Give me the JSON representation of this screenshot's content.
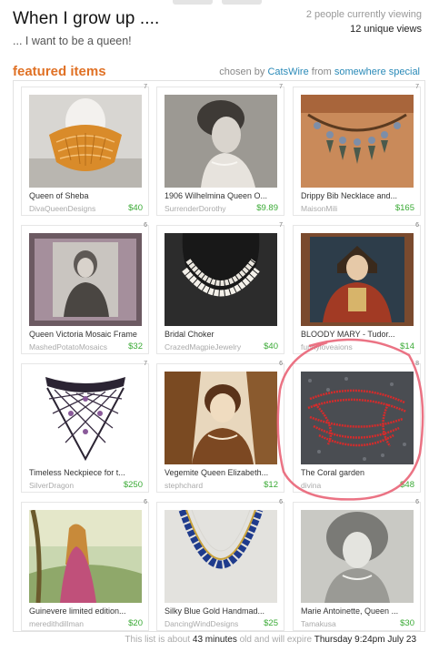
{
  "header": {
    "title": "When I grow up ....",
    "subtitle": "... I want to be a queen!",
    "viewing": "2 people currently viewing",
    "views": "12 unique views"
  },
  "featured": {
    "label": "featured items",
    "chosen_prefix": "chosen by",
    "curator": "CatsWire",
    "from_word": "from",
    "location": "somewhere special"
  },
  "items": [
    {
      "num": "7",
      "title": "Queen of Sheba",
      "seller": "DivaQueenDesigns",
      "price": "$40"
    },
    {
      "num": "7",
      "title": "1906  Wilhelmina Queen O...",
      "seller": "SurrenderDorothy",
      "price": "$9.89"
    },
    {
      "num": "7",
      "title": "Drippy Bib Necklace and...",
      "seller": "MaisonMili",
      "price": "$165"
    },
    {
      "num": "6",
      "title": "Queen Victoria Mosaic Frame",
      "seller": "MashedPotatoMosaics",
      "price": "$32"
    },
    {
      "num": "7",
      "title": "Bridal Choker",
      "seller": "CrazedMagpieJewelry",
      "price": "$40"
    },
    {
      "num": "6",
      "title": "BLOODY MARY - Tudor...",
      "seller": "funnyloveaions",
      "price": "$14"
    },
    {
      "num": "7",
      "title": "Timeless Neckpiece for t...",
      "seller": "SilverDragon",
      "price": "$250"
    },
    {
      "num": "6",
      "title": "Vegemite Queen Elizabeth...",
      "seller": "stephchard",
      "price": "$12"
    },
    {
      "num": "8",
      "title": "The Coral garden",
      "seller": "divina",
      "price": "$48"
    },
    {
      "num": "6",
      "title": "Guinevere limited edition...",
      "seller": "meredithdillman",
      "price": "$20"
    },
    {
      "num": "6",
      "title": "Silky Blue Gold Handmad...",
      "seller": "DancingWindDesigns",
      "price": "$25"
    },
    {
      "num": "6",
      "title": "Marie Antoinette, Queen ...",
      "seller": "Tamakusa",
      "price": "$30"
    }
  ],
  "footer": {
    "prefix": "This list is about",
    "age": "43 minutes",
    "middle": "old and will expire",
    "expires": "Thursday 9:24pm  July 23"
  },
  "colors": {
    "featured": "#e07125",
    "link": "#2a8ab8",
    "price": "#3aaa35",
    "annotation": "#e85a6e"
  }
}
